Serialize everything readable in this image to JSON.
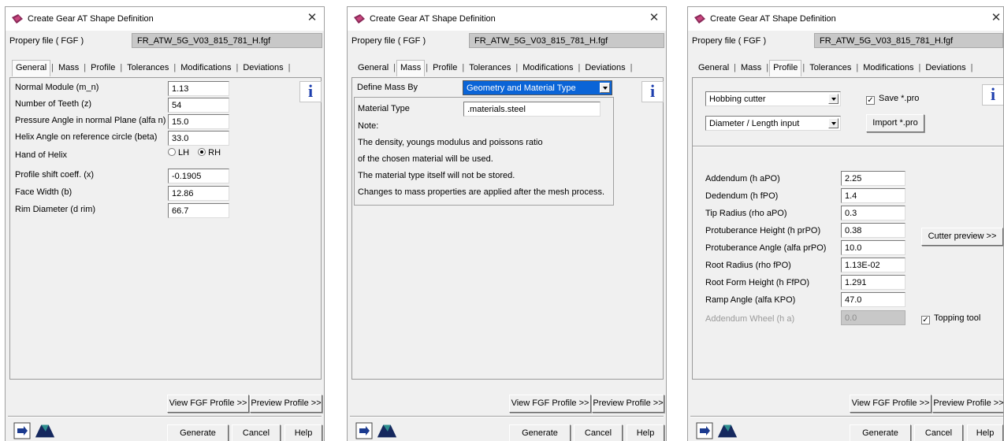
{
  "colors": {
    "dialog_bg": "#f0f0f0",
    "selected_bg": "#0a64d7",
    "info_blue": "#1e3fae",
    "disabled_field": "#c8c8c8"
  },
  "dialogs": [
    {
      "title": "Create Gear AT Shape Definition",
      "file_label": "Propery file ( FGF )",
      "file_value": "FR_ATW_5G_V03_815_781_H.fgf",
      "tabs": [
        "General",
        "Mass",
        "Profile",
        "Tolerances",
        "Modifications",
        "Deviations"
      ],
      "active_tab": "General",
      "info_icon": "i",
      "fields": [
        {
          "label": "Normal Module (m_n)",
          "value": "1.13"
        },
        {
          "label": "Number of Teeth (z)",
          "value": "54"
        },
        {
          "label": "Pressure Angle in normal Plane (alfa n)",
          "value": "15.0"
        },
        {
          "label": "Helix Angle on reference circle (beta)",
          "value": "33.0"
        }
      ],
      "hand": {
        "label": "Hand of Helix",
        "lh": "LH",
        "rh": "RH",
        "selected": "RH"
      },
      "fields2": [
        {
          "label": "Profile shift coeff. (x)",
          "value": "-0.1905"
        },
        {
          "label": "Face Width (b)",
          "value": "12.86"
        },
        {
          "label": "Rim Diameter (d rim)",
          "value": "66.7"
        }
      ],
      "view_fgf": "View FGF Profile >>",
      "preview": "Preview Profile >>",
      "generate": "Generate",
      "cancel": "Cancel",
      "help": "Help"
    },
    {
      "title": "Create Gear AT Shape Definition",
      "file_label": "Propery file ( FGF )",
      "file_value": "FR_ATW_5G_V03_815_781_H.fgf",
      "tabs": [
        "General",
        "Mass",
        "Profile",
        "Tolerances",
        "Modifications",
        "Deviations"
      ],
      "active_tab": "Mass",
      "info_icon": "i",
      "define_mass_label": "Define Mass By",
      "define_mass_value": "Geometry and Material Type",
      "material_type_label": "Material Type",
      "material_type_value": ".materials.steel",
      "notes": [
        "Note:",
        "The density, youngs modulus and poissons ratio",
        "of the chosen material will be used.",
        "The material type itself will not be stored.",
        "Changes to mass properties are applied after the mesh process."
      ],
      "view_fgf": "View FGF Profile >>",
      "preview": "Preview Profile >>",
      "generate": "Generate",
      "cancel": "Cancel",
      "help": "Help"
    },
    {
      "title": "Create Gear AT Shape Definition",
      "file_label": "Propery file ( FGF )",
      "file_value": "FR_ATW_5G_V03_815_781_H.fgf",
      "tabs": [
        "General",
        "Mass",
        "Profile",
        "Tolerances",
        "Modifications",
        "Deviations"
      ],
      "active_tab": "Profile",
      "info_icon": "i",
      "cutter_select": "Hobbing cutter",
      "save_pro_label": "Save *.pro",
      "save_pro_checked": true,
      "input_mode_select": "Diameter / Length input",
      "import_pro": "Import *.pro",
      "fields": [
        {
          "label": "Addendum (h aPO)",
          "value": "2.25"
        },
        {
          "label": "Dedendum (h fPO)",
          "value": "1.4"
        },
        {
          "label": "Tip Radius (rho aPO)",
          "value": "0.3"
        },
        {
          "label": "Protuberance Height (h prPO)",
          "value": "0.38"
        },
        {
          "label": "Protuberance Angle (alfa prPO)",
          "value": "10.0"
        },
        {
          "label": "Root Radius (rho fPO)",
          "value": "1.13E-02"
        },
        {
          "label": "Root Form Height (h FfPO)",
          "value": "1.291"
        },
        {
          "label": "Ramp Angle (alfa KPO)",
          "value": "47.0"
        }
      ],
      "addendum_wheel": {
        "label": "Addendum Wheel (h a)",
        "value": "0.0"
      },
      "cutter_preview": "Cutter preview >>",
      "topping_label": "Topping tool",
      "topping_checked": true,
      "view_fgf": "View FGF Profile >>",
      "preview": "Preview Profile >>",
      "generate": "Generate",
      "cancel": "Cancel",
      "help": "Help"
    }
  ]
}
